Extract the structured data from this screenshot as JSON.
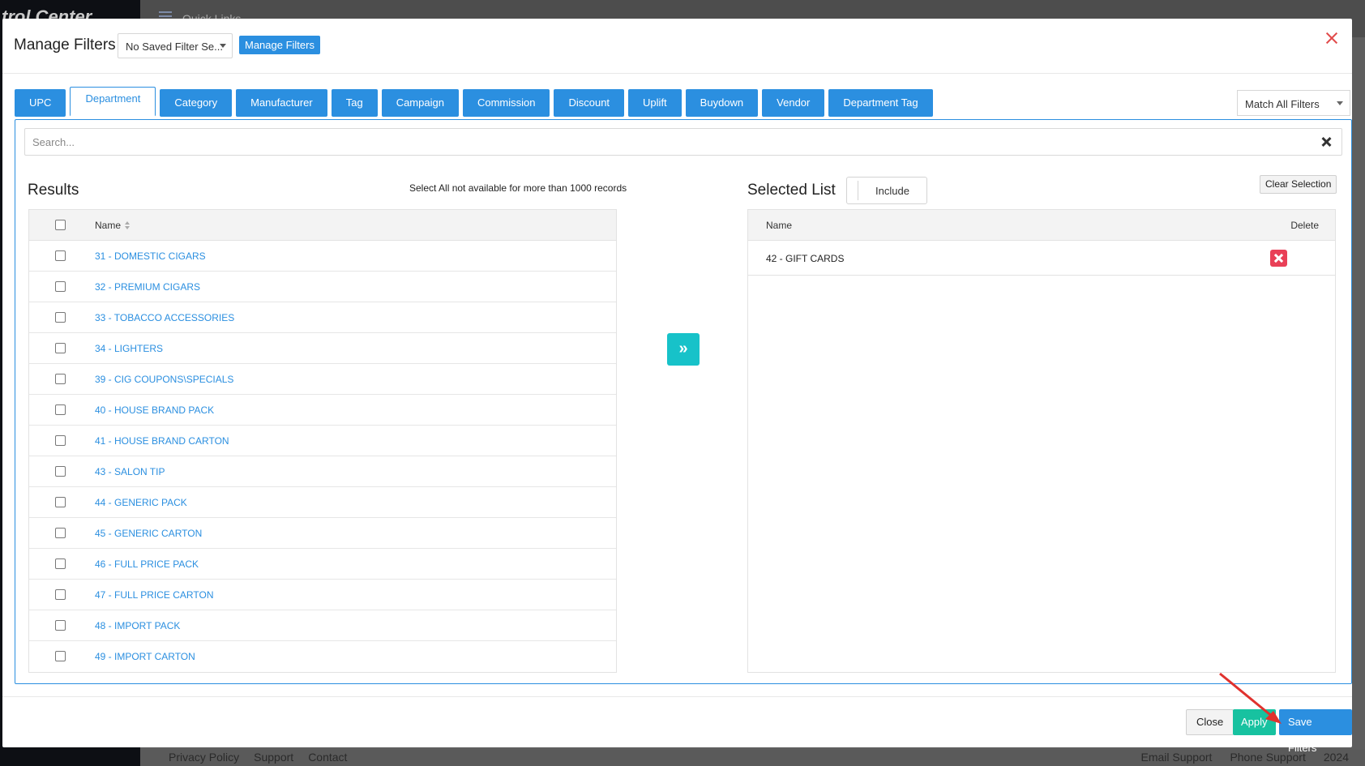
{
  "background": {
    "brand": "trol Center",
    "quick_links": "Quick Links",
    "footer_links": [
      "Privacy Policy",
      "Support",
      "Contact"
    ],
    "footer_right": [
      "Email Support",
      "Phone Support",
      "2024"
    ]
  },
  "modal": {
    "title": "Manage Filters",
    "saved_filter": "No Saved Filter Se...",
    "manage_filters_label": "Manage Filters"
  },
  "tabs": [
    {
      "label": "UPC"
    },
    {
      "label": "Department",
      "active": true
    },
    {
      "label": "Category"
    },
    {
      "label": "Manufacturer"
    },
    {
      "label": "Tag"
    },
    {
      "label": "Campaign"
    },
    {
      "label": "Commission"
    },
    {
      "label": "Discount"
    },
    {
      "label": "Uplift"
    },
    {
      "label": "Buydown"
    },
    {
      "label": "Vendor"
    },
    {
      "label": "Department Tag"
    }
  ],
  "match_filter": "Match All Filters",
  "search": {
    "placeholder": "Search..."
  },
  "results": {
    "title": "Results",
    "note": "Select All not available for more than 1000 records",
    "column_name": "Name",
    "rows": [
      "31 - DOMESTIC CIGARS",
      "32 - PREMIUM CIGARS",
      "33 - TOBACCO ACCESSORIES",
      "34 - LIGHTERS",
      "39 - CIG COUPONS\\SPECIALS",
      "40 - HOUSE BRAND PACK",
      "41 - HOUSE BRAND CARTON",
      "43 - SALON TIP",
      "44 - GENERIC PACK",
      "45 - GENERIC CARTON",
      "46 - FULL PRICE PACK",
      "47 - FULL PRICE CARTON",
      "48 - IMPORT PACK",
      "49 - IMPORT CARTON"
    ]
  },
  "selected": {
    "title": "Selected List",
    "include_label": "Include",
    "clear_label": "Clear Selection",
    "column_name": "Name",
    "column_delete": "Delete",
    "rows": [
      "42 - GIFT CARDS"
    ]
  },
  "footer": {
    "close_label": "Close",
    "apply_label": "Apply",
    "save_label": "Save Filters"
  },
  "colors": {
    "primary": "#2b8fe0",
    "teal": "#17c2c9",
    "delete": "#e94057",
    "arrow": "#e0322e"
  }
}
